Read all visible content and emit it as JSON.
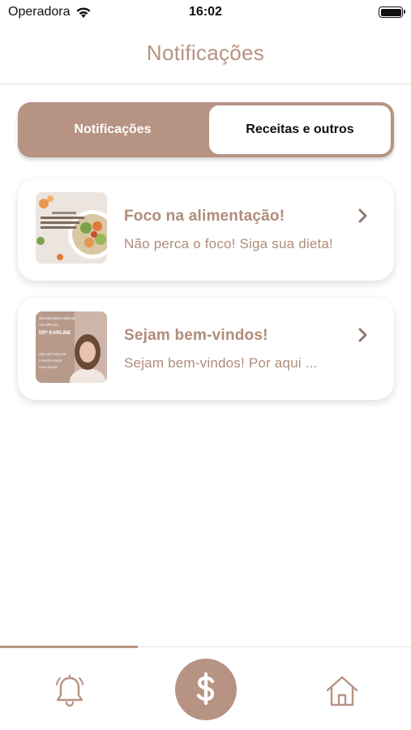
{
  "status_bar": {
    "carrier": "Operadora",
    "time": "16:02"
  },
  "header": {
    "title": "Notificações"
  },
  "segmented": {
    "left_label": "Notificações",
    "right_label": "Receitas e outros",
    "active": "left"
  },
  "notifications": [
    {
      "title": "Foco na alimentação!",
      "subtitle": "Não perca o foco! Siga sua dieta!",
      "thumbnail": "food-bowl-photo"
    },
    {
      "title": "Sejam bem-vindos!",
      "subtitle": "Sejam bem-vindos! Por aqui ...",
      "thumbnail": "doctor-portrait-photo",
      "thumbnail_text": [
        "SEJAM BEM-VINDOS",
        "AO APP DA",
        "DRª KARLINE",
        "SEU MÉTODO DE",
        "LONGEVIDADE",
        "VITALIDADE"
      ]
    }
  ],
  "tabbar": {
    "items": [
      "bell-icon",
      "dollar-icon",
      "home-icon"
    ],
    "active_index": 0
  },
  "colors": {
    "accent": "#b79383",
    "text_accent": "#b08c7a",
    "header_title": "#b89282"
  }
}
